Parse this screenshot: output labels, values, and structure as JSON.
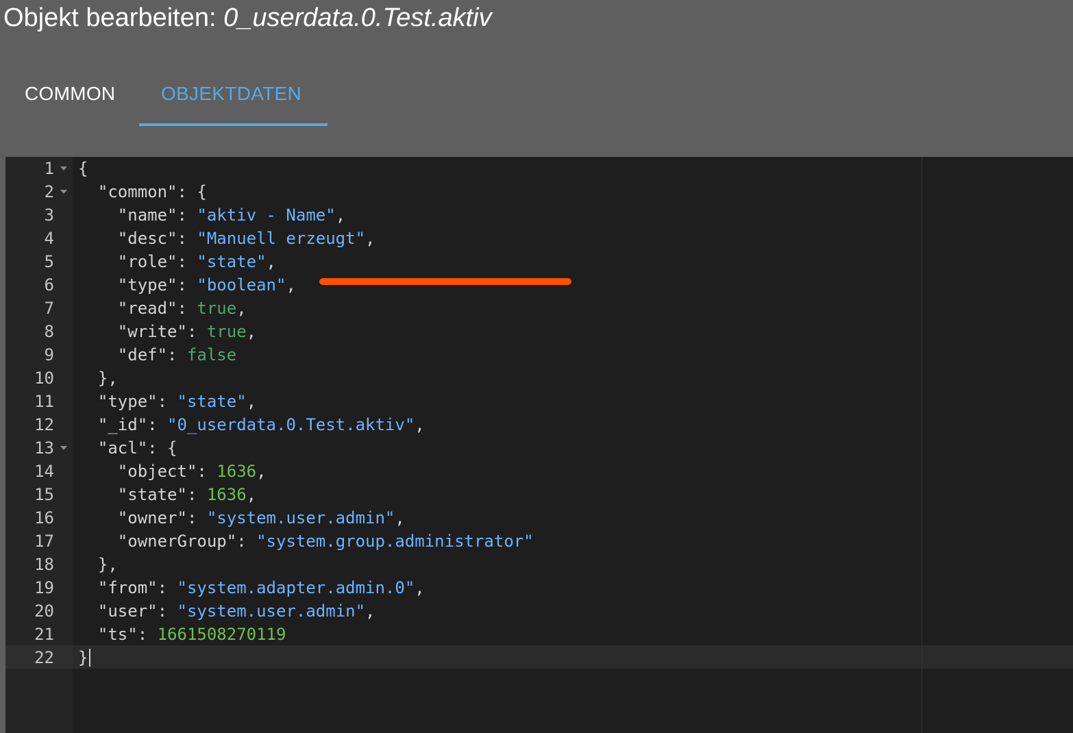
{
  "dialog": {
    "title_prefix": "Objekt bearbeiten: ",
    "object_id": "0_userdata.0.Test.aktiv"
  },
  "tabs": [
    {
      "label": "COMMON",
      "active": false
    },
    {
      "label": "OBJEKTDATEN",
      "active": true
    }
  ],
  "editor": {
    "lines": [
      {
        "n": "1",
        "fold": true,
        "tokens": [
          [
            "p",
            "{"
          ]
        ]
      },
      {
        "n": "2",
        "fold": true,
        "tokens": [
          [
            "p",
            "  \"common\": {"
          ]
        ]
      },
      {
        "n": "3",
        "tokens": [
          [
            "p",
            "    \"name\": "
          ],
          [
            "s",
            "\"aktiv - Name\""
          ],
          [
            "p",
            ","
          ]
        ]
      },
      {
        "n": "4",
        "tokens": [
          [
            "p",
            "    \"desc\": "
          ],
          [
            "s",
            "\"Manuell erzeugt\""
          ],
          [
            "p",
            ","
          ]
        ]
      },
      {
        "n": "5",
        "tokens": [
          [
            "p",
            "    \"role\": "
          ],
          [
            "s",
            "\"state\""
          ],
          [
            "p",
            ","
          ]
        ]
      },
      {
        "n": "6",
        "tokens": [
          [
            "p",
            "    \"type\": "
          ],
          [
            "s",
            "\"boolean\""
          ],
          [
            "p",
            ","
          ]
        ]
      },
      {
        "n": "7",
        "tokens": [
          [
            "p",
            "    \"read\": "
          ],
          [
            "k",
            "true"
          ],
          [
            "p",
            ","
          ]
        ]
      },
      {
        "n": "8",
        "tokens": [
          [
            "p",
            "    \"write\": "
          ],
          [
            "k",
            "true"
          ],
          [
            "p",
            ","
          ]
        ]
      },
      {
        "n": "9",
        "tokens": [
          [
            "p",
            "    \"def\": "
          ],
          [
            "k",
            "false"
          ]
        ]
      },
      {
        "n": "10",
        "tokens": [
          [
            "p",
            "  },"
          ]
        ]
      },
      {
        "n": "11",
        "tokens": [
          [
            "p",
            "  \"type\": "
          ],
          [
            "s",
            "\"state\""
          ],
          [
            "p",
            ","
          ]
        ]
      },
      {
        "n": "12",
        "tokens": [
          [
            "p",
            "  \"_id\": "
          ],
          [
            "s",
            "\"0_userdata.0.Test.aktiv\""
          ],
          [
            "p",
            ","
          ]
        ]
      },
      {
        "n": "13",
        "fold": true,
        "tokens": [
          [
            "p",
            "  \"acl\": {"
          ]
        ]
      },
      {
        "n": "14",
        "tokens": [
          [
            "p",
            "    \"object\": "
          ],
          [
            "n",
            "1636"
          ],
          [
            "p",
            ","
          ]
        ]
      },
      {
        "n": "15",
        "tokens": [
          [
            "p",
            "    \"state\": "
          ],
          [
            "n",
            "1636"
          ],
          [
            "p",
            ","
          ]
        ]
      },
      {
        "n": "16",
        "tokens": [
          [
            "p",
            "    \"owner\": "
          ],
          [
            "s",
            "\"system.user.admin\""
          ],
          [
            "p",
            ","
          ]
        ]
      },
      {
        "n": "17",
        "tokens": [
          [
            "p",
            "    \"ownerGroup\": "
          ],
          [
            "s",
            "\"system.group.administrator\""
          ]
        ]
      },
      {
        "n": "18",
        "tokens": [
          [
            "p",
            "  },"
          ]
        ]
      },
      {
        "n": "19",
        "tokens": [
          [
            "p",
            "  \"from\": "
          ],
          [
            "s",
            "\"system.adapter.admin.0\""
          ],
          [
            "p",
            ","
          ]
        ]
      },
      {
        "n": "20",
        "tokens": [
          [
            "p",
            "  \"user\": "
          ],
          [
            "s",
            "\"system.user.admin\""
          ],
          [
            "p",
            ","
          ]
        ]
      },
      {
        "n": "21",
        "tokens": [
          [
            "p",
            "  \"ts\": "
          ],
          [
            "n",
            "1661508270119"
          ]
        ]
      },
      {
        "n": "22",
        "tokens": [
          [
            "p",
            "}"
          ]
        ]
      }
    ],
    "active_line": "22"
  },
  "colors": {
    "background": "#5f5f5f",
    "editor_bg": "#1e1e1e",
    "accent": "#54a9e9",
    "string": "#6cb3ff",
    "keyword": "#4fa674",
    "number": "#6cc24a",
    "annotation": "#ff5100"
  }
}
